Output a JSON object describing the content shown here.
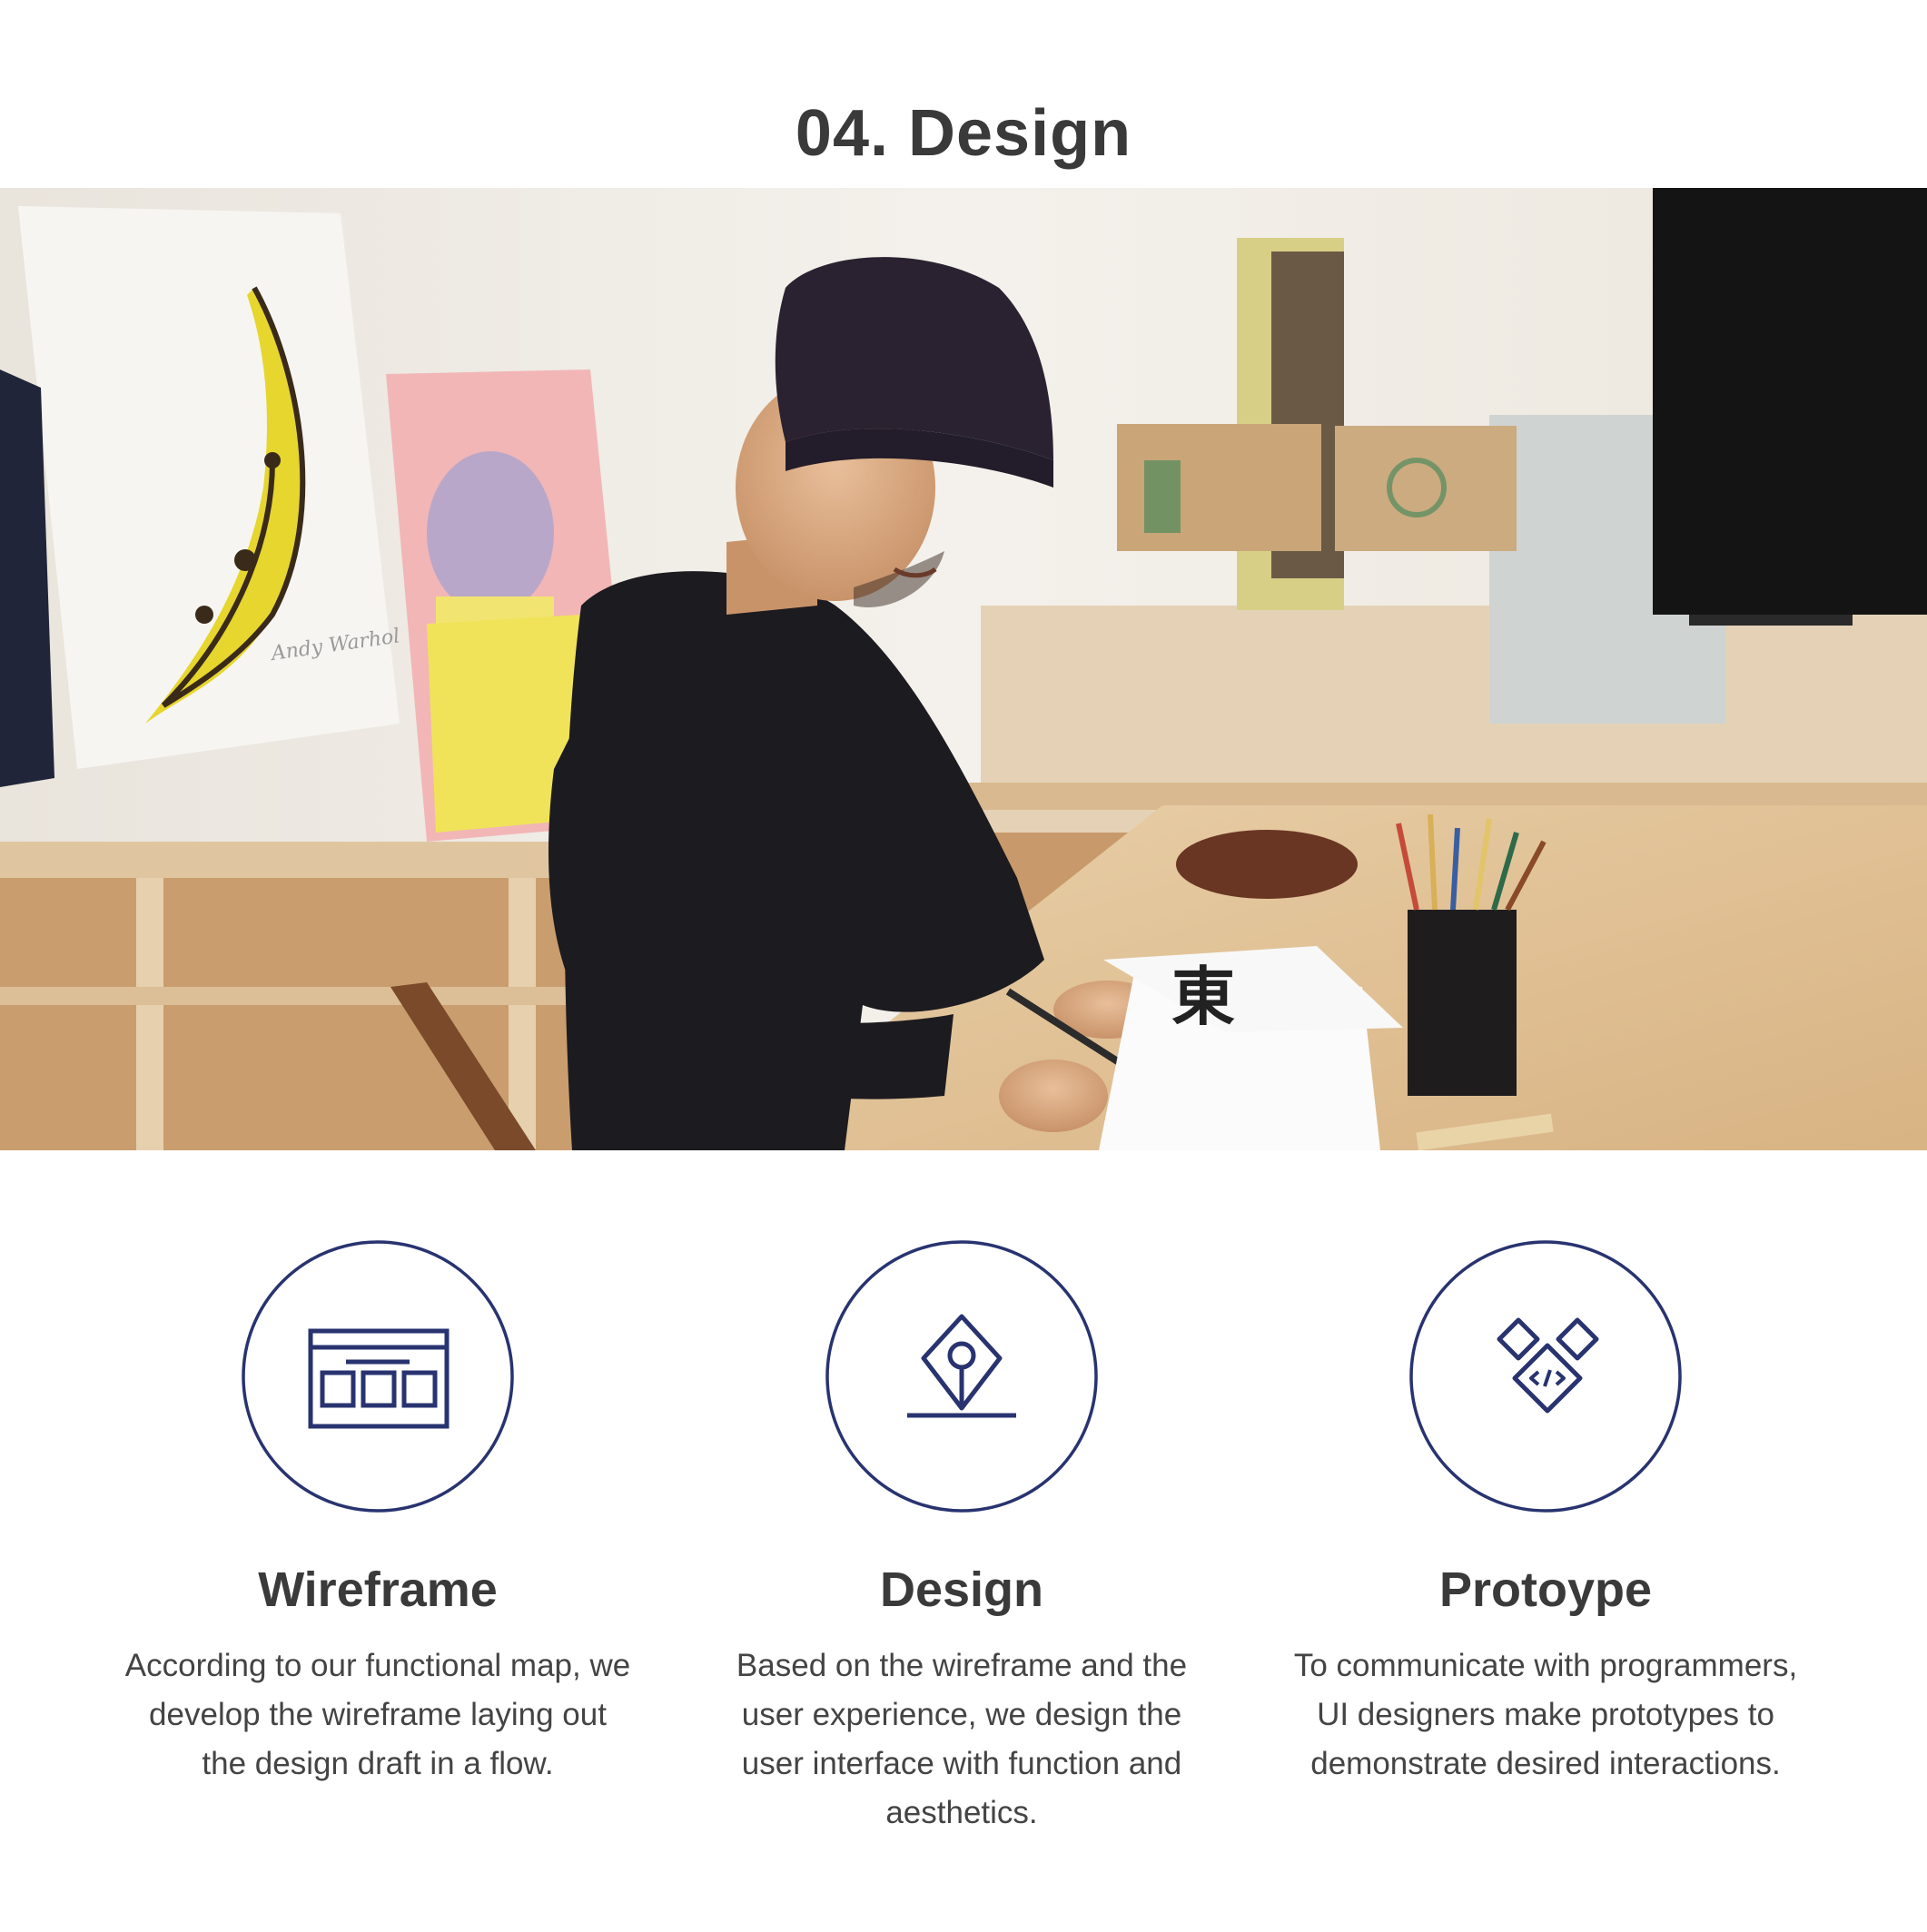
{
  "page": {
    "title": "04. Design"
  },
  "hero": {
    "image": "photo-designer-sketching-at-desk",
    "signature": "Andy Warhol"
  },
  "colors": {
    "accent": "#283370",
    "heading": "#3a3a3a",
    "body_text": "#444444",
    "background": "#ffffff"
  },
  "features": [
    {
      "icon": "wireframe-icon",
      "title": "Wireframe",
      "description": "According to our functional map, we develop the wireframe laying out the design draft in a flow."
    },
    {
      "icon": "pen-nib-icon",
      "title": "Design",
      "description": "Based on the wireframe and the user experience, we design the user interface with function and aesthetics."
    },
    {
      "icon": "code-diamond-icon",
      "title": "Protoype",
      "description": "To communicate with programmers, UI designers make prototypes to demonstrate desired interactions."
    }
  ]
}
